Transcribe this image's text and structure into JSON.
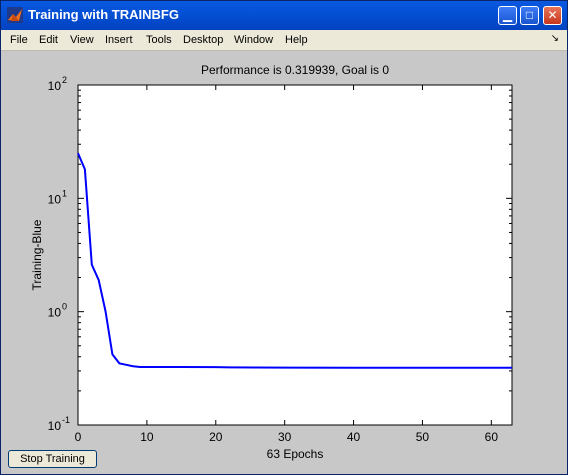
{
  "window": {
    "title": "Training with TRAINBFG",
    "minimize_icon": "minimize-icon",
    "maximize_icon": "maximize-icon",
    "close_icon": "close-icon",
    "app_icon": "matlab-icon"
  },
  "menu": {
    "items": [
      "File",
      "Edit",
      "View",
      "Insert",
      "Tools",
      "Desktop",
      "Window",
      "Help"
    ],
    "dock_icon": "dock-arrow-icon"
  },
  "chart_data": {
    "type": "line",
    "title": "Performance is 0.319939, Goal is 0",
    "xlabel": "63 Epochs",
    "ylabel": "Training-Blue",
    "yscale": "log",
    "xlim": [
      0,
      63
    ],
    "ylim": [
      0.1,
      100
    ],
    "x_ticks": [
      "0",
      "10",
      "20",
      "30",
      "40",
      "50",
      "60"
    ],
    "y_ticks": [
      {
        "base": "10",
        "exp": "-1"
      },
      {
        "base": "10",
        "exp": "0"
      },
      {
        "base": "10",
        "exp": "1"
      },
      {
        "base": "10",
        "exp": "2"
      }
    ],
    "grid": false,
    "series": [
      {
        "color": "#0000ff",
        "x": [
          0,
          1,
          2,
          3,
          4,
          5,
          6,
          7,
          8,
          9,
          10,
          15,
          20,
          22,
          30,
          40,
          50,
          63
        ],
        "y": [
          25,
          18,
          2.6,
          1.9,
          1.0,
          0.42,
          0.35,
          0.34,
          0.33,
          0.325,
          0.325,
          0.325,
          0.324,
          0.322,
          0.321,
          0.32,
          0.32,
          0.319939
        ]
      }
    ]
  },
  "controls": {
    "stop_label": "Stop Training"
  }
}
